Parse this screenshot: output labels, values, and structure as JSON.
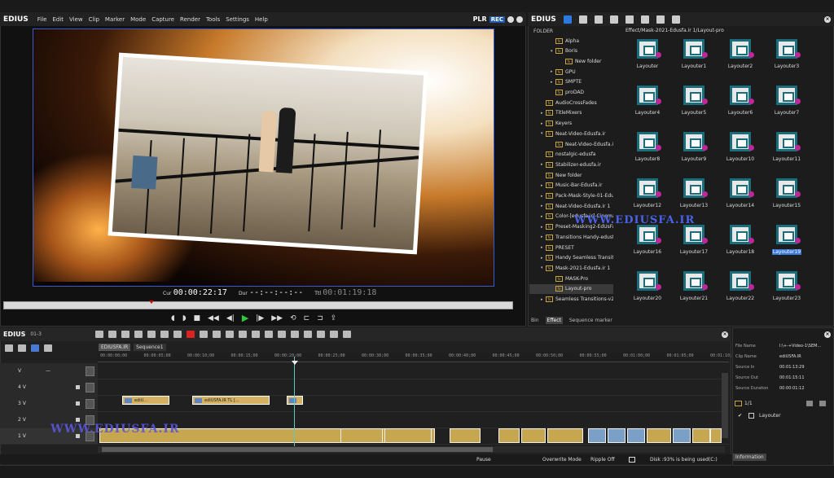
{
  "player": {
    "app_name": "EDIUS",
    "menu": [
      "File",
      "Edit",
      "View",
      "Clip",
      "Marker",
      "Mode",
      "Capture",
      "Render",
      "Tools",
      "Settings",
      "Help"
    ],
    "mode_label": "PLR",
    "rec_label": "REC",
    "cur_label": "Cur",
    "cur_tc": "00:00:22:17",
    "dur_label": "Dur",
    "dur_tc": "--:--:--:--",
    "ttl_label": "Ttl",
    "ttl_tc": "00:01:19:18"
  },
  "effects": {
    "app_name": "EDIUS",
    "folder_header": "FOLDER",
    "path": "Effect/Mask-2021-Edusfa.ir 1/Layout-pro",
    "tree": [
      {
        "label": "Alpha",
        "indent": 1,
        "arrow": ""
      },
      {
        "label": "Boris",
        "indent": 1,
        "arrow": "▾"
      },
      {
        "label": "New folder",
        "indent": 2,
        "arrow": ""
      },
      {
        "label": "GPU",
        "indent": 1,
        "arrow": "▸"
      },
      {
        "label": "SMPTE",
        "indent": 1,
        "arrow": "▸"
      },
      {
        "label": "proDAD",
        "indent": 1,
        "arrow": ""
      },
      {
        "label": "AudioCrossFades",
        "indent": 0,
        "arrow": ""
      },
      {
        "label": "TitleMixers",
        "indent": 0,
        "arrow": "▸"
      },
      {
        "label": "Keyers",
        "indent": 0,
        "arrow": "▸"
      },
      {
        "label": "Neat-Video-Edusfa.ir",
        "indent": 0,
        "arrow": "▾"
      },
      {
        "label": "Neat-Video-Edusfa.ir",
        "indent": 1,
        "arrow": ""
      },
      {
        "label": "nostalgic-edusfa",
        "indent": 0,
        "arrow": ""
      },
      {
        "label": "Stabilizer-edusfa.ir",
        "indent": 0,
        "arrow": "▸"
      },
      {
        "label": "New folder",
        "indent": 0,
        "arrow": ""
      },
      {
        "label": "Music-Bar-Edusfa.ir",
        "indent": 0,
        "arrow": "▸"
      },
      {
        "label": "Pack-Mask-Style-01-Edusfa",
        "indent": 0,
        "arrow": "▸"
      },
      {
        "label": "Neat-Video-Edusfa.ir 1",
        "indent": 0,
        "arrow": "▸"
      },
      {
        "label": "Color-[edusfa.ir]-Cinemati",
        "indent": 0,
        "arrow": "▸"
      },
      {
        "label": "Preset-Masking2-EdUsFa.ir",
        "indent": 0,
        "arrow": "▸"
      },
      {
        "label": "Transitions Handy-edusfa.ir",
        "indent": 0,
        "arrow": "▸"
      },
      {
        "label": "PRESET",
        "indent": 0,
        "arrow": "▸"
      },
      {
        "label": "Handy Seamless Transitions",
        "indent": 0,
        "arrow": "▸"
      },
      {
        "label": "Mask-2021-Edusfa.ir 1",
        "indent": 0,
        "arrow": "▾"
      },
      {
        "label": "MASK-Pro",
        "indent": 1,
        "arrow": ""
      },
      {
        "label": "Layout-pro",
        "indent": 1,
        "arrow": "",
        "selected": true
      },
      {
        "label": "Seamless Transitions-v2[ed",
        "indent": 0,
        "arrow": "▸"
      }
    ],
    "items": [
      "Layouter",
      "Layouter1",
      "Layouter2",
      "Layouter3",
      "Layouter4",
      "Layouter5",
      "Layouter6",
      "Layouter7",
      "Layouter8",
      "Layouter9",
      "Layouter10",
      "Layouter11",
      "Layouter12",
      "Layouter13",
      "Layouter14",
      "Layouter15",
      "Layouter16",
      "Layouter17",
      "Layouter18",
      "Layouter19",
      "Layouter20",
      "Layouter21",
      "Layouter22",
      "Layouter23"
    ],
    "selected_item": "Layouter19",
    "tabs": [
      "Bin",
      "Effect",
      "Sequence marker"
    ],
    "active_tab": "Effect",
    "watermark": "WWW.EDIUSFA.IR"
  },
  "timeline": {
    "app_name": "EDIUS",
    "sub": "01-3",
    "tabs": [
      "EDIUSFA.IR",
      "Sequence1"
    ],
    "ruler": [
      "00:00:00;00",
      "00:00:05;00",
      "00:00:10;00",
      "00:00:15;00",
      "00:00:20;00",
      "00:00:25;00",
      "00:00:30;00",
      "00:00:35;00",
      "00:00:40;00",
      "00:00:45;00",
      "00:00:50;00",
      "00:00:55;00",
      "00:01:00;00",
      "00:01:05;00",
      "00:01:10;00",
      "00:01:15;00"
    ],
    "tracks": [
      "V",
      "4 V",
      "3 V",
      "2 V",
      "1 V"
    ],
    "clips_3v": [
      "ediU...",
      "edIUSFA.IR  TL [...",
      ""
    ],
    "watermark": "WWW.EDIUSFA.IR"
  },
  "status": {
    "state": "Pause",
    "mode": "Overwrite Mode",
    "ripple": "Ripple Off",
    "disk": "Disk :93% is being used(C:)"
  },
  "info": {
    "rows": [
      {
        "k": "File Name",
        "v": "I:\\+-+Video-1\\SEM..."
      },
      {
        "k": "Clip Name",
        "v": "ediUSFA.IR"
      },
      {
        "k": "Source In",
        "v": "00:01:13:29"
      },
      {
        "k": "Source Out",
        "v": "00:01:15:11"
      },
      {
        "k": "Source Duration",
        "v": "00:00:01:12"
      }
    ],
    "counter": "1/1",
    "effect": "Layouter",
    "tab": "Information"
  }
}
